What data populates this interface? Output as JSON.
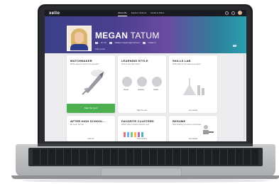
{
  "app": {
    "logo": "xello"
  },
  "nav": {
    "links": [
      "About Me",
      "Explore Options",
      "Goals & Plans"
    ]
  },
  "profile": {
    "first_name": "MEGAN",
    "last_name": "TATUM",
    "grade": "Gr 10",
    "school": "Walker Creek High School",
    "extra": "Grade 9",
    "edit": "Edit profile"
  },
  "cards": {
    "matchmaker": {
      "title": "MATCHMAKER",
      "subtitle": "Which careers match your interests?",
      "button": "Start the Quiz"
    },
    "learning_style": {
      "title": "LEARNING STYLE",
      "subtitle": "How do you learn best?",
      "items": [
        "Visual",
        "Auditory",
        "Tactile"
      ],
      "footer": "Take the quiz"
    },
    "skills_lab": {
      "title": "SKILLS LAB",
      "subtitle": "What skills do you want to develop?",
      "footer": "Get started"
    },
    "after_high_school": {
      "title": "AFTER HIGH SCHOOL...",
      "subtitle": "My Goal: Not Set",
      "footer": "Add one"
    },
    "favorite_clusters": {
      "title": "FAVORITE CLUSTERS",
      "subtitle": "Which career clusters interest you?",
      "footer": "Find clusters"
    },
    "resume": {
      "title": "RESUME",
      "subtitle": "Start building a resume to showcase",
      "footer": "Get started"
    }
  },
  "colors": {
    "accent": "#4caf50",
    "nav": "#1a1a22"
  }
}
